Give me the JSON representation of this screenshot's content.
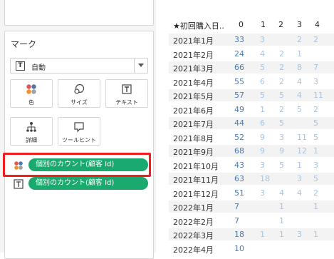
{
  "marks": {
    "title": "マーク",
    "mark_type": "自動",
    "tiles": [
      {
        "icon": "color-icon",
        "label": "色"
      },
      {
        "icon": "size-icon",
        "label": "サイズ"
      },
      {
        "icon": "text-icon",
        "label": "テキスト"
      },
      {
        "icon": "detail-icon",
        "label": "詳細"
      },
      {
        "icon": "tooltip-icon",
        "label": "ツールヒント"
      }
    ],
    "pills": [
      {
        "icon": "color-icon",
        "label": "個別のカウント(顧客 Id)"
      },
      {
        "icon": "text-icon",
        "label": "個別のカウント(顧客 Id)"
      }
    ]
  },
  "table": {
    "row_header": "★初回購入日..",
    "columns": [
      "0",
      "1",
      "2",
      "3",
      "4"
    ],
    "rows": [
      {
        "label": "2021年1月",
        "values": [
          "33",
          "3",
          "",
          "2",
          "2"
        ]
      },
      {
        "label": "2021年2月",
        "values": [
          "24",
          "4",
          "2",
          "1",
          ""
        ]
      },
      {
        "label": "2021年3月",
        "values": [
          "66",
          "5",
          "2",
          "8",
          "7"
        ]
      },
      {
        "label": "2021年4月",
        "values": [
          "55",
          "6",
          "2",
          "4",
          "3"
        ]
      },
      {
        "label": "2021年5月",
        "values": [
          "57",
          "5",
          "5",
          "4",
          "11"
        ]
      },
      {
        "label": "2021年6月",
        "values": [
          "49",
          "1",
          "2",
          "5",
          "2"
        ]
      },
      {
        "label": "2021年7月",
        "values": [
          "44",
          "6",
          "5",
          "",
          "5"
        ]
      },
      {
        "label": "2021年8月",
        "values": [
          "52",
          "9",
          "3",
          "11",
          "5"
        ]
      },
      {
        "label": "2021年9月",
        "values": [
          "68",
          "9",
          "9",
          "12",
          "1"
        ]
      },
      {
        "label": "2021年10月",
        "values": [
          "43",
          "3",
          "5",
          "1",
          "3"
        ]
      },
      {
        "label": "2021年11月",
        "values": [
          "63",
          "18",
          "",
          "3",
          "5"
        ]
      },
      {
        "label": "2021年12月",
        "values": [
          "51",
          "3",
          "4",
          "4",
          "2"
        ]
      },
      {
        "label": "2022年1月",
        "values": [
          "7",
          "",
          "1",
          "",
          "1"
        ]
      },
      {
        "label": "2022年2月",
        "values": [
          "7",
          "",
          "1",
          "",
          ""
        ]
      },
      {
        "label": "2022年3月",
        "values": [
          "18",
          "1",
          "1",
          "3",
          "1"
        ]
      },
      {
        "label": "2022年4月",
        "values": [
          "10",
          "",
          "",
          "",
          ""
        ]
      }
    ]
  },
  "colors": {
    "pill_green": "#1aa96e",
    "highlight_red": "#f01e1e",
    "value_dark": "#4a7ab0",
    "value_light": "#a9c3df"
  }
}
